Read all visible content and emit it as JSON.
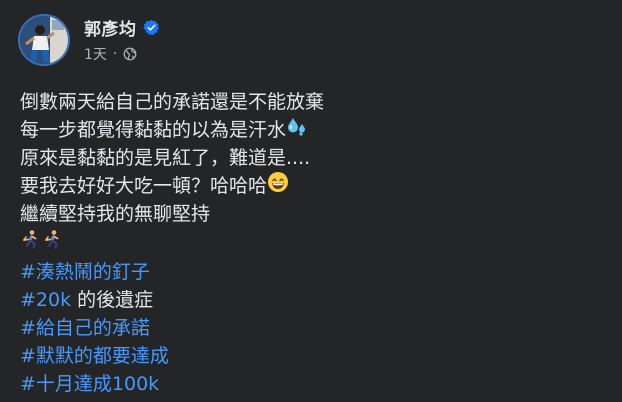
{
  "post": {
    "author": "郭彥均",
    "timestamp": "1天",
    "separator": "·",
    "privacy_icon": "globe-icon",
    "verified_icon": "verified-badge-icon",
    "lines": [
      "倒數兩天給自己的承諾還是不能放棄",
      "每一步都覺得黏黏的以為是汗水",
      "原來是黏黏的是見紅了，難道是....",
      "要我去好好大吃一頓？哈哈哈",
      "繼續堅持我的無聊堅持"
    ],
    "line_emojis": [
      "",
      "sweat-droplets-emoji",
      "",
      "grinning-face-emoji",
      ""
    ],
    "runner_emojis": [
      "runner-emoji",
      "runner-emoji"
    ],
    "hashtags": [
      {
        "tag": "#湊熱鬧的釘子",
        "suffix": ""
      },
      {
        "tag": "#20k",
        "suffix": " 的後遺症"
      },
      {
        "tag": "#給自己的承諾",
        "suffix": ""
      },
      {
        "tag": "#默默的都要達成",
        "suffix": ""
      },
      {
        "tag": "#十月達成100k",
        "suffix": ""
      }
    ]
  },
  "colors": {
    "background": "#242526",
    "text": "#e4e6eb",
    "secondary_text": "#b0b3b8",
    "hashtag": "#4599ff",
    "verified": "#1877f2"
  }
}
